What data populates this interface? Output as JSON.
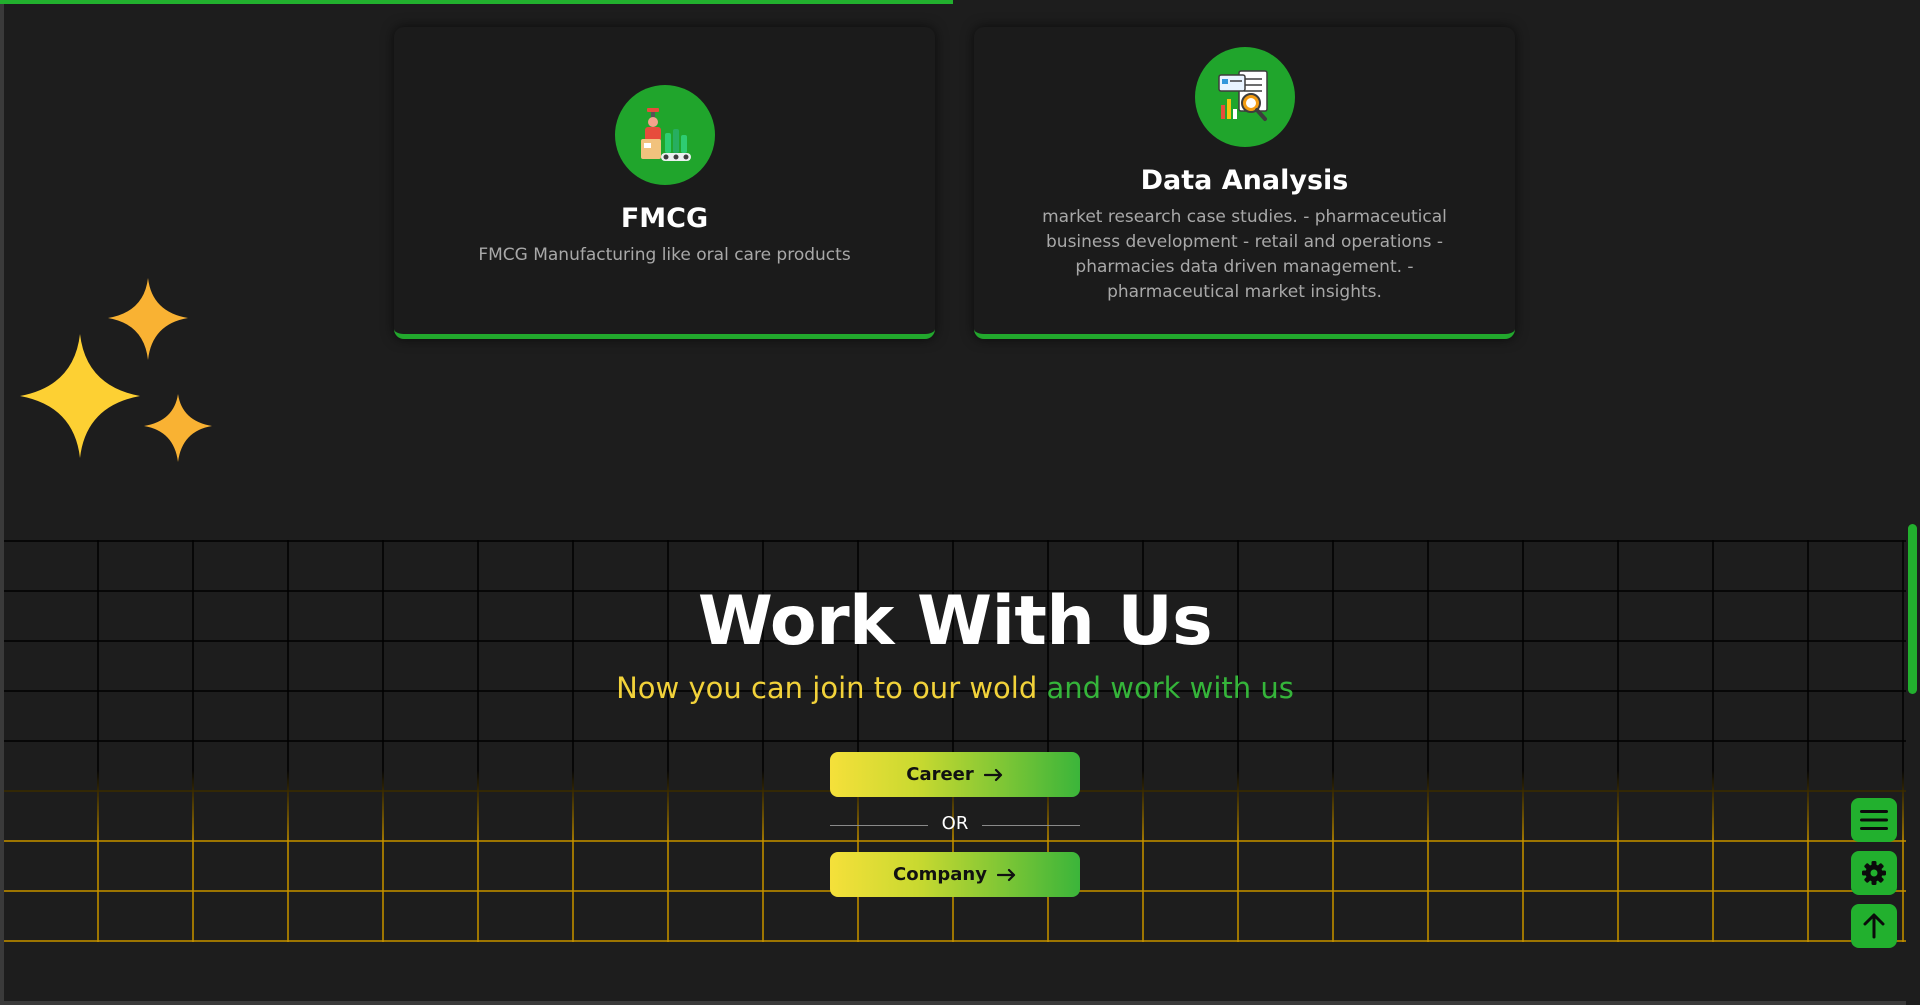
{
  "reading_progress": 0.5,
  "cards": [
    {
      "title": "FMCG",
      "description": "FMCG Manufacturing like oral care products",
      "icon": "factory-icon"
    },
    {
      "title": "Data Analysis",
      "description": "market research case studies. - pharmaceutical business development - retail and operations - pharmacies data driven management. - pharmaceutical market insights.",
      "icon": "data-report-icon"
    }
  ],
  "work_section": {
    "title": "Work With Us",
    "subtitle_part1": "Now you can join to our wold",
    "subtitle_part2": "and work with us",
    "career_label": "Career",
    "or_label": "OR",
    "company_label": "Company"
  },
  "colors": {
    "accent_green": "#22b02e",
    "accent_yellow": "#f2d23a",
    "background": "#1d1d1d"
  },
  "floating_buttons": [
    "menu-icon",
    "gear-icon",
    "arrow-up-icon"
  ]
}
